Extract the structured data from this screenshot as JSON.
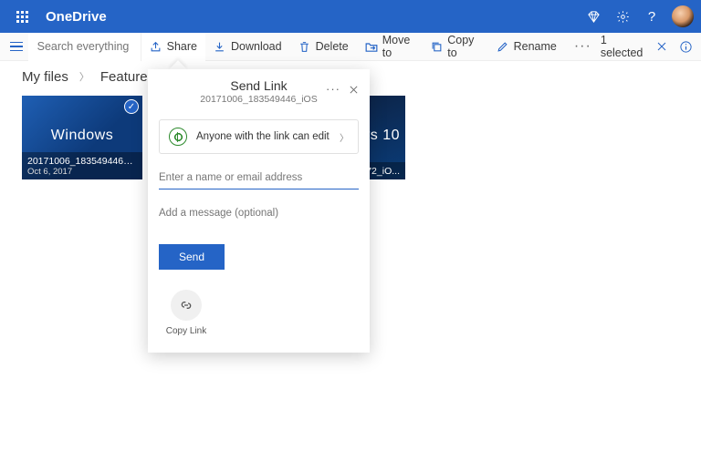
{
  "header": {
    "app_name": "OneDrive"
  },
  "search": {
    "placeholder": "Search everything"
  },
  "commands": {
    "share": "Share",
    "download": "Download",
    "delete": "Delete",
    "move_to": "Move to",
    "copy_to": "Copy to",
    "rename": "Rename",
    "selected_text": "1 selected"
  },
  "breadcrumb": {
    "root": "My files",
    "current": "Featured Images"
  },
  "files": [
    {
      "name": "20171006_183549446_iO...",
      "date": "Oct 6, 2017",
      "overlay": "Windows",
      "selected": true
    },
    {
      "name": "",
      "date": "",
      "overlay": "",
      "selected": false
    },
    {
      "name": "...372_iO...",
      "date": "",
      "overlay": "ws 10",
      "selected": false
    }
  ],
  "share_dialog": {
    "title": "Send Link",
    "filename": "20171006_183549446_iOS",
    "link_scope": "Anyone with the link can edit",
    "name_placeholder": "Enter a name or email address",
    "message_placeholder": "Add a message (optional)",
    "send_label": "Send",
    "copy_link_label": "Copy Link"
  }
}
